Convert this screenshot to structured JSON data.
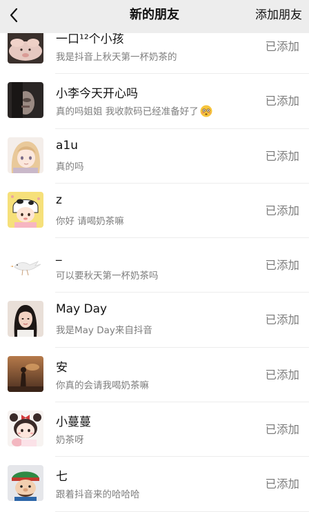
{
  "header": {
    "back_icon": "chevron-left-icon",
    "title": "新的朋友",
    "action_label": "添加朋友"
  },
  "friends": [
    {
      "name": "一口¹²个小孩",
      "message": "我是抖音上秋天第一杯奶茶的",
      "status": "已添加",
      "avatar": "pig-avatar"
    },
    {
      "name": "小李今天开心吗",
      "message": "真的吗姐姐  我收款码已经准备好了",
      "emoji": "flushed-face-emoji",
      "status": "已添加",
      "avatar": "portrait-dark-avatar"
    },
    {
      "name": "a1u",
      "message": "真的吗",
      "status": "已添加",
      "avatar": "anime-girl-avatar"
    },
    {
      "name": "z",
      "message": "你好 请喝奶茶嘛",
      "status": "已添加",
      "avatar": "cow-girl-avatar"
    },
    {
      "name": "_",
      "message": "可以要秋天第一杯奶茶吗",
      "status": "已添加",
      "avatar": "bird-avatar"
    },
    {
      "name": "May  Day",
      "message": "我是May  Day来自抖音",
      "status": "已添加",
      "avatar": "woman-photo-avatar"
    },
    {
      "name": "安",
      "message": "你真的会请我喝奶茶嘛",
      "status": "已添加",
      "avatar": "sunset-avatar"
    },
    {
      "name": "小蔓蔓",
      "message": "奶茶呀",
      "status": "已添加",
      "avatar": "bow-girl-avatar"
    },
    {
      "name": "七",
      "message": "跟着抖音来的哈哈哈",
      "status": "已添加",
      "avatar": "cartoon-character-avatar"
    }
  ]
}
